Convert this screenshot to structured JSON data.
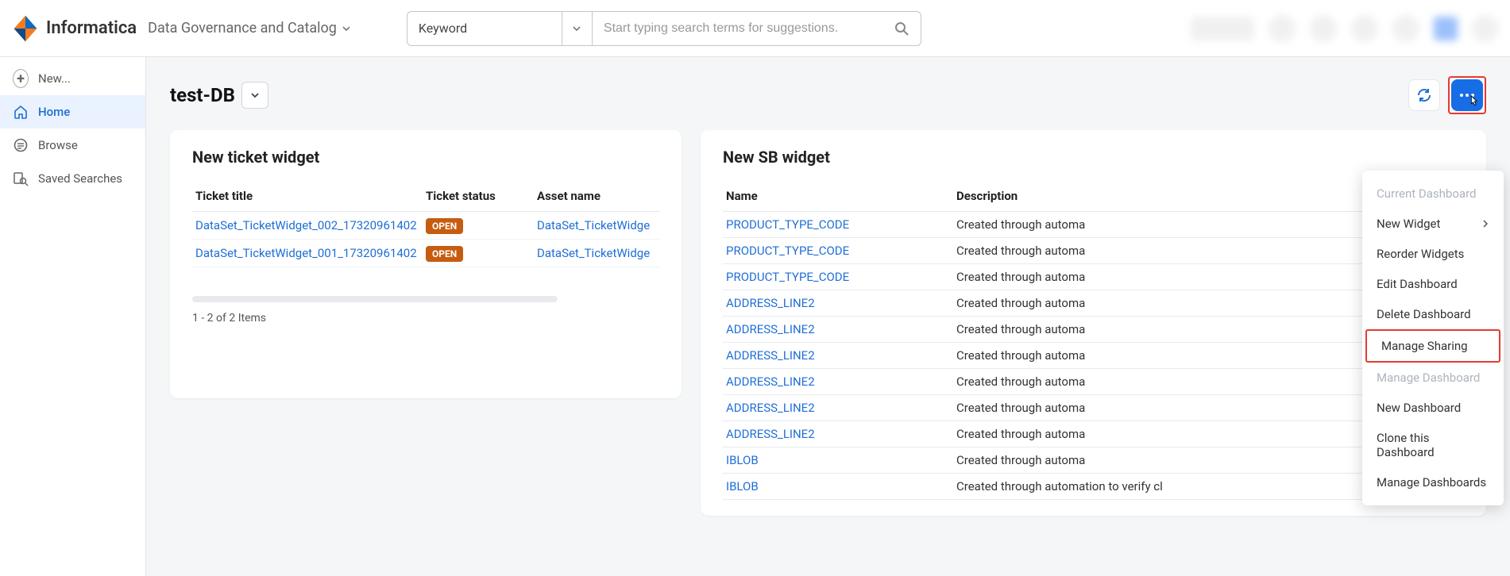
{
  "header": {
    "brand": "Informatica",
    "product": "Data Governance and Catalog",
    "search": {
      "type_label": "Keyword",
      "placeholder": "Start typing search terms for suggestions."
    }
  },
  "sidebar": {
    "new_label": "New...",
    "items": [
      {
        "label": "Home",
        "icon": "home",
        "active": true
      },
      {
        "label": "Browse",
        "icon": "browse",
        "active": false
      },
      {
        "label": "Saved Searches",
        "icon": "saved",
        "active": false
      }
    ]
  },
  "page": {
    "title": "test-DB"
  },
  "widgets": {
    "ticket": {
      "title": "New ticket widget",
      "columns": [
        "Ticket title",
        "Ticket status",
        "Asset name"
      ],
      "rows": [
        {
          "title": "DataSet_TicketWidget_002_17320961402",
          "status": "OPEN",
          "asset": "DataSet_TicketWidge"
        },
        {
          "title": "DataSet_TicketWidget_001_17320961402",
          "status": "OPEN",
          "asset": "DataSet_TicketWidge"
        }
      ],
      "pager": "1 - 2 of 2 Items"
    },
    "sb": {
      "title": "New SB widget",
      "columns": [
        "Name",
        "Description"
      ],
      "rows": [
        {
          "name": "PRODUCT_TYPE_CODE",
          "desc": "Created through automa"
        },
        {
          "name": "PRODUCT_TYPE_CODE",
          "desc": "Created through automa"
        },
        {
          "name": "PRODUCT_TYPE_CODE",
          "desc": "Created through automa"
        },
        {
          "name": "ADDRESS_LINE2",
          "desc": "Created through automa"
        },
        {
          "name": "ADDRESS_LINE2",
          "desc": "Created through automa"
        },
        {
          "name": "ADDRESS_LINE2",
          "desc": "Created through automa"
        },
        {
          "name": "ADDRESS_LINE2",
          "desc": "Created through automa"
        },
        {
          "name": "ADDRESS_LINE2",
          "desc": "Created through automa"
        },
        {
          "name": "ADDRESS_LINE2",
          "desc": "Created through automa"
        },
        {
          "name": "IBLOB",
          "desc": "Created through automa"
        },
        {
          "name": "IBLOB",
          "desc": "Created through automation to verify cl"
        }
      ]
    }
  },
  "menu": {
    "header": "Current Dashboard",
    "items": [
      {
        "label": "New Widget",
        "submenu": true,
        "disabled": false
      },
      {
        "label": "Reorder Widgets",
        "disabled": false
      },
      {
        "label": "Edit Dashboard",
        "disabled": false
      },
      {
        "label": "Delete Dashboard",
        "disabled": false
      },
      {
        "label": "Manage Sharing",
        "disabled": false,
        "highlight": true
      },
      {
        "label": "Manage Dashboard",
        "disabled": true
      },
      {
        "label": "New Dashboard",
        "disabled": false
      },
      {
        "label": "Clone this Dashboard",
        "disabled": false
      },
      {
        "label": "Manage Dashboards",
        "disabled": false
      }
    ]
  }
}
